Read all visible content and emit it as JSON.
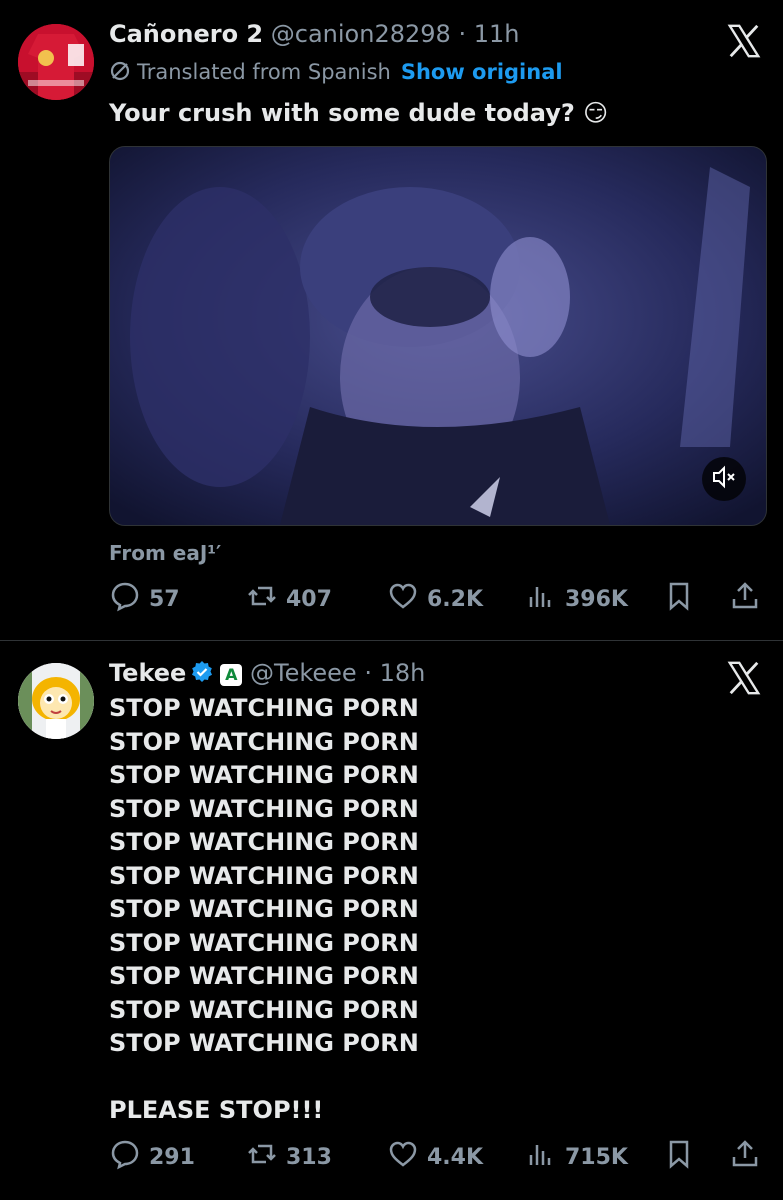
{
  "posts": [
    {
      "name": "Cañonero 2",
      "handle": "@canion28298",
      "separator": "·",
      "time": "11h",
      "translated_label": "Translated from Spanish",
      "show_original": "Show original",
      "text": "Your crush with some dude today? 😏",
      "from": "From eaJ¹′",
      "actions": {
        "replies": "57",
        "reposts": "407",
        "likes": "6.2K",
        "views": "396K"
      }
    },
    {
      "name": "Tekee",
      "affiliate_badge": "A",
      "handle": "@Tekeee",
      "separator": "·",
      "time": "18h",
      "lines": [
        "STOP WATCHING PORN",
        "STOP WATCHING PORN",
        "STOP WATCHING PORN",
        "STOP WATCHING PORN",
        "STOP WATCHING PORN",
        "STOP WATCHING PORN",
        "STOP WATCHING PORN",
        "STOP WATCHING PORN",
        "STOP WATCHING PORN",
        "STOP WATCHING PORN",
        "STOP WATCHING PORN",
        "",
        "PLEASE STOP!!!"
      ],
      "actions": {
        "replies": "291",
        "reposts": "313",
        "likes": "4.4K",
        "views": "715K"
      }
    }
  ],
  "colors": {
    "background": "#000000",
    "text": "#e7e9ea",
    "secondary": "#8b98a5",
    "link": "#1d9bf0",
    "divider": "#2f3336"
  }
}
